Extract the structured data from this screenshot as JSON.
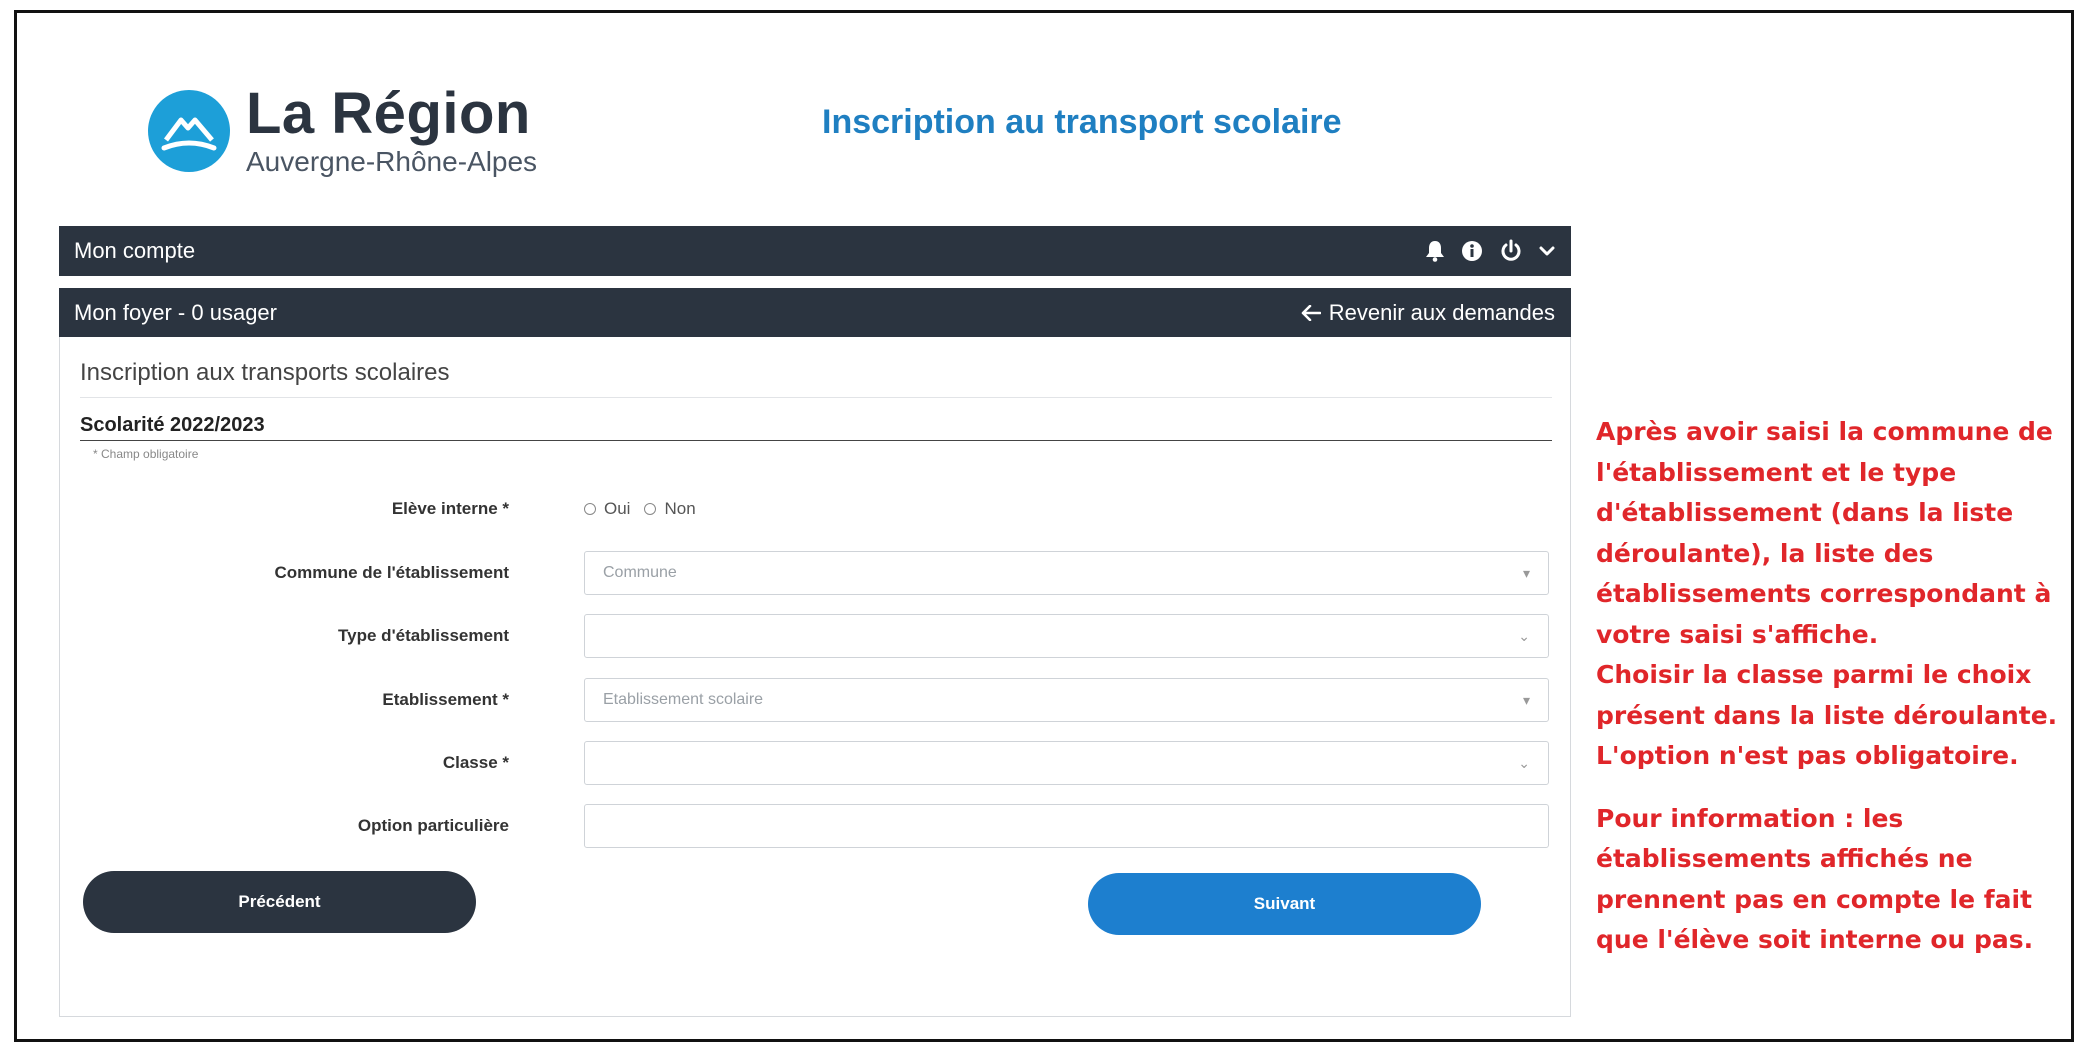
{
  "header": {
    "logo_name": "La Région",
    "logo_sub": "Auvergne-Rhône-Alpes",
    "app_title": "Inscription au transport scolaire"
  },
  "account_bar": {
    "label": "Mon compte",
    "icons": [
      "bell-icon",
      "info-icon",
      "power-icon",
      "chevron-down-icon"
    ]
  },
  "household_bar": {
    "label": "Mon foyer - 0 usager",
    "back_link": "Revenir aux demandes"
  },
  "panel": {
    "title": "Inscription aux transports scolaires",
    "section_title": "Scolarité 2022/2023",
    "mandatory_note": "* Champ obligatoire"
  },
  "form": {
    "interne": {
      "label": "Elève interne *",
      "options": [
        "Oui",
        "Non"
      ]
    },
    "commune": {
      "label": "Commune de l'établissement",
      "placeholder": "Commune"
    },
    "type": {
      "label": "Type d'établissement",
      "value": ""
    },
    "etablissement": {
      "label": "Etablissement *",
      "placeholder": "Etablissement scolaire"
    },
    "classe": {
      "label": "Classe *",
      "value": ""
    },
    "option": {
      "label": "Option particulière",
      "value": ""
    }
  },
  "buttons": {
    "prev": "Précédent",
    "next": "Suivant"
  },
  "note": {
    "paragraph1": [
      "Après avoir saisi la commune de",
      "l'établissement et le type",
      "d'établissement (dans la liste",
      "déroulante), la liste des",
      "établissements correspondant à",
      "votre saisi s'affiche.",
      "Choisir la classe parmi le choix",
      "présent dans la liste déroulante.",
      "L'option n'est pas obligatoire."
    ],
    "paragraph2": [
      "Pour information : les",
      "établissements affichés ne",
      "prennent pas en compte le fait",
      "que l'élève soit interne ou pas."
    ]
  },
  "colors": {
    "dark_bar": "#2b3440",
    "brand_blue": "#1d9fd8",
    "title_blue": "#1f7fc1",
    "next_button": "#1d7fcf",
    "note_red": "#e0262a"
  }
}
